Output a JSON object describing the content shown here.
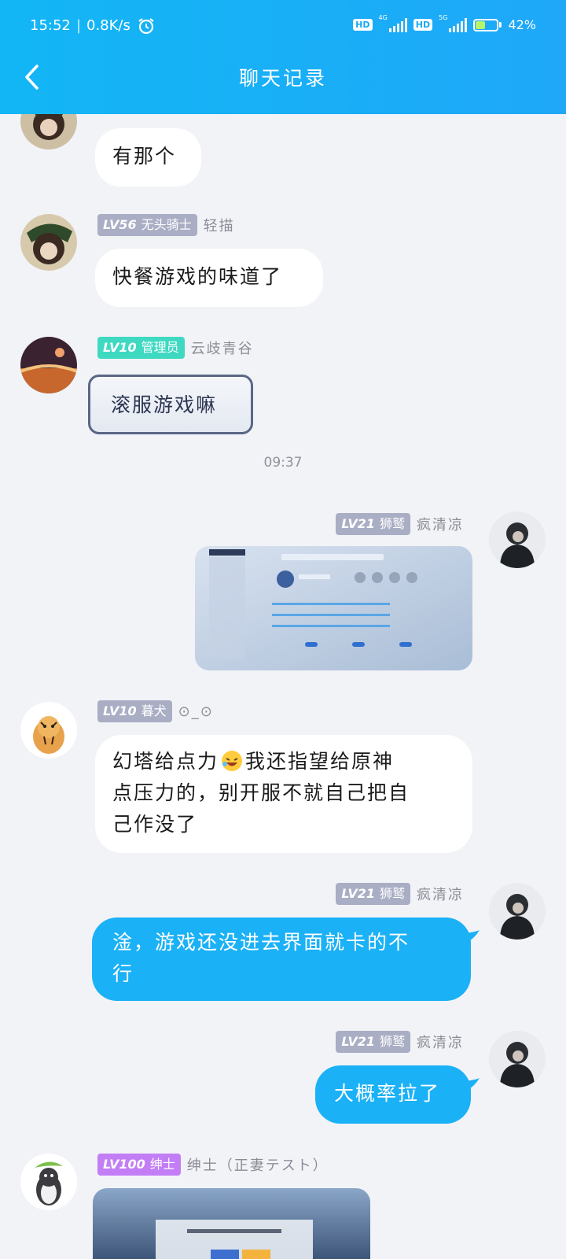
{
  "status_bar": {
    "time": "15:52",
    "separator": "|",
    "speed": "0.8K/s",
    "hd1": "HD",
    "net1": "4G",
    "hd2": "HD",
    "net2": "5G",
    "battery": "42%",
    "battery_level": 0.42
  },
  "header": {
    "title": "聊天记录",
    "back_icon": "chevron-left-icon",
    "color": "#12b6f5"
  },
  "messages": [
    {
      "text": "有那个"
    },
    {
      "level": "LV56",
      "role": "无头骑士",
      "nick": "轻描",
      "text": "快餐游戏的味道了"
    },
    {
      "level": "LV10",
      "role": "管理员",
      "nick": "云歧青谷",
      "text": "滚服游戏嘛"
    },
    {
      "level": "LV21",
      "role": "狮鹫",
      "nick": "疯清凉"
    },
    {
      "level": "LV10",
      "role": "暮犬",
      "nick": "⊙_⊙",
      "text1": "幻塔给点力",
      "text2": "我还指望给原神",
      "text3": "点压力的，别开服不就自己把自",
      "text4": "己作没了"
    },
    {
      "level": "LV21",
      "role": "狮鹫",
      "nick": "疯清凉",
      "text1": "淦，游戏还没进去界面就卡的不",
      "text2": "行"
    },
    {
      "level": "LV21",
      "role": "狮鹫",
      "nick": "疯清凉",
      "text": "大概率拉了"
    },
    {
      "level": "LV100",
      "role": "绅士",
      "nick": "绅士（正妻テスト）"
    }
  ],
  "timestamp": "09:37"
}
